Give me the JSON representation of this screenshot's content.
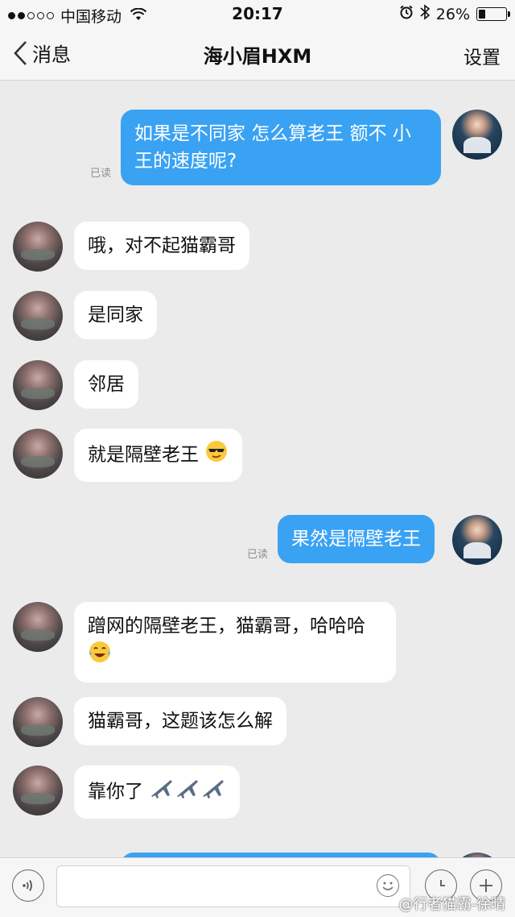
{
  "status_bar": {
    "carrier": "中国移动",
    "time": "20:17",
    "battery": "26%",
    "battery_level": 0.26
  },
  "nav": {
    "back_label": "消息",
    "title": "海小眉HXM",
    "settings_label": "设置"
  },
  "messages": [
    {
      "from": "self",
      "text": "如果是不同家 怎么算老王 额不 小王的速度呢?",
      "status": "已读"
    },
    {
      "from": "other",
      "text": "哦，对不起猫霸哥"
    },
    {
      "from": "other",
      "text": "是同家"
    },
    {
      "from": "other",
      "text": "邻居"
    },
    {
      "from": "other",
      "text": "就是隔壁老王",
      "emoji": "cool-face-emoji"
    },
    {
      "from": "self",
      "text": "果然是隔壁老王",
      "status": "已读"
    },
    {
      "from": "other",
      "text": "蹭网的隔壁老王，猫霸哥，哈哈哈",
      "emoji": "laughing-tears-emoji"
    },
    {
      "from": "other",
      "text": "猫霸哥，这题该怎么解"
    },
    {
      "from": "other",
      "text": "靠你了",
      "emoji": "airplane-emoji-x3"
    }
  ],
  "input": {
    "placeholder": ""
  },
  "watermark": "@行者猫霸-徐晴",
  "colors": {
    "self_bubble": "#3aa2f3",
    "other_bubble": "#ffffff",
    "background": "#ebebeb"
  }
}
